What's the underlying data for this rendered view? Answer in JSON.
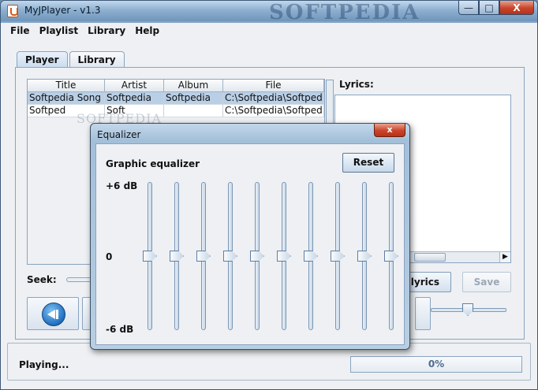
{
  "window": {
    "title": "MyJPlayer - v1.3",
    "watermark": "SOFTPEDIA",
    "buttons": {
      "minimize": "—",
      "maximize": "□",
      "close": "X"
    }
  },
  "menu": [
    "File",
    "Playlist",
    "Library",
    "Help"
  ],
  "tabs": [
    "Player",
    "Library"
  ],
  "playlist": {
    "columns": [
      "Title",
      "Artist",
      "Album",
      "File"
    ],
    "rows": [
      [
        "Softpedia Song",
        "Softpedia",
        "Softpedia",
        "C:\\Softpedia\\Softped..."
      ],
      [
        "Softped",
        "Soft",
        "",
        "C:\\Softpedia\\Softped..."
      ]
    ]
  },
  "lyrics": {
    "label": "Lyrics:"
  },
  "seek": {
    "label": "Seek:"
  },
  "buttons": {
    "edit_lyrics": "Edit lyrics",
    "save": "Save"
  },
  "status": {
    "text": "Playing...",
    "progress_label": "0%",
    "progress": 0
  },
  "overlay_watermark": "SOFTPEDIA",
  "equalizer": {
    "title": "Equalizer",
    "close": "x",
    "heading": "Graphic equalizer",
    "reset_label": "Reset",
    "labels": {
      "top": "+6 dB",
      "mid": "0",
      "bottom": "-6 dB"
    },
    "band_levels": [
      0,
      0,
      0,
      0,
      0,
      0,
      0,
      0,
      0,
      0
    ]
  }
}
